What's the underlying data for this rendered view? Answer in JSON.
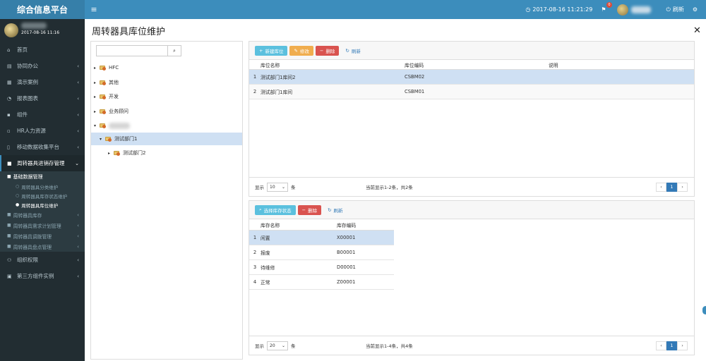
{
  "app": {
    "title": "综合信息平台"
  },
  "header": {
    "datetime": "2017-08-16 11:21:29",
    "notification_count": "0",
    "refresh_label": "刷新"
  },
  "sidebar": {
    "user_time": "2017-08-16 11:16",
    "items": [
      {
        "icon": "home-icon",
        "label": "首页",
        "has_children": false
      },
      {
        "icon": "document-icon",
        "label": "协同办公",
        "has_children": true
      },
      {
        "icon": "grid-icon",
        "label": "演示案例",
        "has_children": true
      },
      {
        "icon": "chart-icon",
        "label": "报表图表",
        "has_children": true
      },
      {
        "icon": "component-icon",
        "label": "组件",
        "has_children": true
      },
      {
        "icon": "hr-icon",
        "label": "HR人力资源",
        "has_children": true
      },
      {
        "icon": "mobile-icon",
        "label": "移动数据收集平台",
        "has_children": true
      },
      {
        "icon": "folder-icon",
        "label": "周转器具进销存管理",
        "has_children": true
      }
    ],
    "submenu": {
      "head": "基础数据管理",
      "leaves": [
        "周转器具分类维护",
        "周转器具库存状态维护",
        "周转器具库位维护"
      ],
      "rows": [
        "周转器具库存",
        "周转器具需求计划管理",
        "周转器具调拨管理",
        "周转器具盘点管理"
      ]
    },
    "bottom_items": [
      {
        "icon": "users-icon",
        "label": "组织权限"
      },
      {
        "icon": "plugin-icon",
        "label": "第三方组件实例"
      }
    ]
  },
  "page": {
    "title": "周转器具库位维护"
  },
  "tree": {
    "nodes": [
      "HFC",
      "其他",
      "开发",
      "业务顾问",
      "测试部门1",
      "测试部门2"
    ]
  },
  "grid1": {
    "toolbar": {
      "add": "新建库位",
      "edit": "修改",
      "delete": "删除",
      "refresh": "刷新"
    },
    "columns": [
      "库位名称",
      "库位编码",
      "说明"
    ],
    "rows": [
      {
        "num": "1",
        "name": "测试部门1库间2",
        "code": "CSBM02",
        "desc": ""
      },
      {
        "num": "2",
        "name": "测试部门1库间",
        "code": "CSBM01",
        "desc": ""
      }
    ],
    "footer": {
      "show": "显示",
      "page_size": "10",
      "unit": "条",
      "info": "当前显示1-2条，共2条",
      "page": "1"
    }
  },
  "grid2": {
    "toolbar": {
      "select": "选择库存状态",
      "delete": "删除",
      "refresh": "刷新"
    },
    "columns": [
      "库存名称",
      "库存编码"
    ],
    "rows": [
      {
        "num": "1",
        "name": "闲置",
        "code": "X00001"
      },
      {
        "num": "2",
        "name": "报废",
        "code": "B00001"
      },
      {
        "num": "3",
        "name": "待维修",
        "code": "D00001"
      },
      {
        "num": "4",
        "name": "正常",
        "code": "Z00001"
      }
    ],
    "footer": {
      "show": "显示",
      "page_size": "20",
      "unit": "条",
      "info": "当前显示1-4条，共4条",
      "page": "1"
    }
  },
  "colors": {
    "header": "#3c8dbc",
    "logo": "#367fa9",
    "sidebar": "#222d32",
    "btn_info": "#5bc0de",
    "btn_warning": "#f0ad4e",
    "btn_danger": "#d9534f",
    "selected_row": "#cfe0f3",
    "pager_active": "#337ab7"
  }
}
